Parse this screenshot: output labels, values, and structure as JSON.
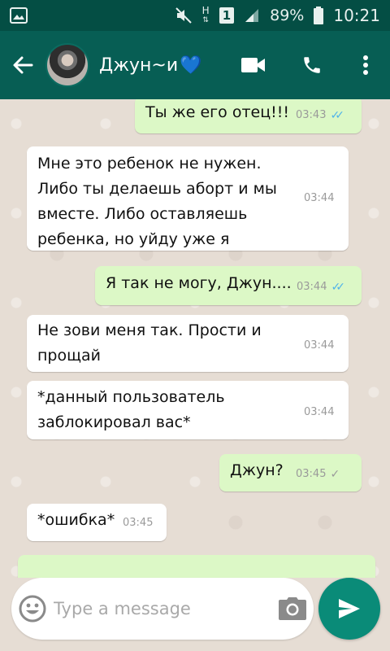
{
  "status_bar": {
    "battery_percent": "89%",
    "time": "10:21",
    "sim_slot": "1",
    "network": "H"
  },
  "header": {
    "contact_name": "Джун~и",
    "heart": "💙"
  },
  "messages": [
    {
      "direction": "out",
      "text": "Ты же его отец!!!",
      "time": "03:43",
      "status": "read"
    },
    {
      "direction": "in",
      "lines": [
        "Мне это ребенок не нужен.",
        "Либо ты делаешь аборт и мы",
        "вместе. Либо оставляешь",
        "ребенка, но уйду уже я"
      ],
      "time": "03:44"
    },
    {
      "direction": "out",
      "text": "Я так не могу, Джун....",
      "time": "03:44",
      "status": "read"
    },
    {
      "direction": "in",
      "lines": [
        "Не зови меня так. Прости и",
        "прощай"
      ],
      "time": "03:44"
    },
    {
      "direction": "in",
      "lines": [
        "*данный пользователь",
        "заблокировал вас*"
      ],
      "time": "03:44"
    },
    {
      "direction": "out",
      "text": "Джун?",
      "time": "03:45",
      "status": "sent"
    },
    {
      "direction": "in",
      "text": "*ошибка*",
      "time": "03:45"
    }
  ],
  "input": {
    "placeholder": "Type a message"
  },
  "colors": {
    "status_bar": "#044e44",
    "header": "#075e54",
    "outgoing_bubble": "#dcf8c6",
    "incoming_bubble": "#ffffff",
    "read_tick": "#4fb3ea",
    "send_button": "#0a8b78"
  },
  "icons": {
    "back": "arrow-left-icon",
    "video": "video-camera-icon",
    "call": "phone-icon",
    "menu": "more-vert-icon",
    "emoji": "emoji-icon",
    "camera": "camera-icon",
    "send": "send-icon"
  }
}
